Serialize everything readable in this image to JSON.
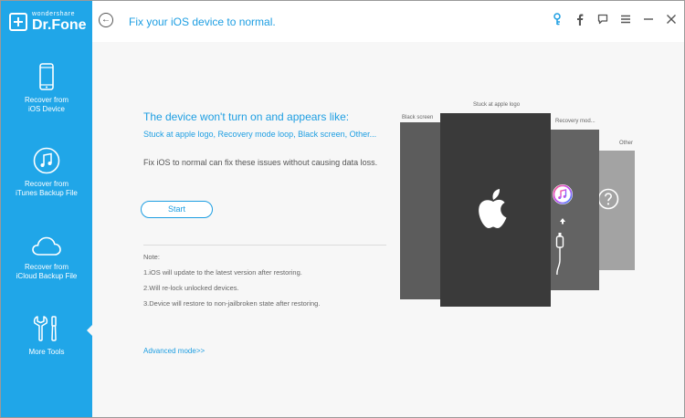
{
  "brand": {
    "small": "wondershare",
    "big": "Dr.Fone"
  },
  "sidebar": {
    "items": [
      {
        "line1": "Recover from",
        "line2": "iOS Device",
        "icon": "phone-icon"
      },
      {
        "line1": "Recover from",
        "line2": "iTunes Backup File",
        "icon": "music-icon"
      },
      {
        "line1": "Recover from",
        "line2": "iCloud Backup File",
        "icon": "cloud-icon"
      },
      {
        "line1": "More Tools",
        "line2": "",
        "icon": "tools-icon"
      }
    ],
    "active_index": 3
  },
  "header": {
    "title": "Fix your iOS device to normal.",
    "icons": [
      "key-icon",
      "facebook-icon",
      "feedback-icon",
      "menu-icon",
      "minimize-icon",
      "close-icon"
    ]
  },
  "main": {
    "headline": "The device won't turn on and appears like:",
    "subline": "Stuck at apple logo, Recovery mode loop, Black screen, Other...",
    "desc": "Fix iOS to normal can fix these issues without causing data loss.",
    "start_label": "Start",
    "notes": [
      "Note:",
      "1.iOS will update to the latest version after restoring.",
      "2.Will re-lock unlocked devices.",
      "3.Device will restore to non-jailbroken state after restoring."
    ],
    "advanced_label": "Advanced mode>>"
  },
  "illustration": {
    "captions": {
      "black": "Black screen",
      "apple": "Stuck at apple logo",
      "recovery": "Recovery mod...",
      "other": "Other"
    }
  },
  "colors": {
    "accent": "#1d9ee2",
    "sidebar": "#20a6e8"
  }
}
